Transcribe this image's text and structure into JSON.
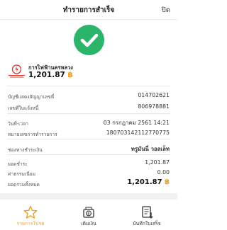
{
  "header": {
    "title": "ทำรายการสำเร็จ",
    "close_label": "ปิด"
  },
  "biller": {
    "logo_text": "การไฟฟ้านครหลวง",
    "name": "การไฟฟ้านครหลวง",
    "amount": "1,201.87",
    "currency_symbol": "฿"
  },
  "details": [
    {
      "label": "บัญชีแสดงสัญญาเลขที่",
      "value": "014702621"
    },
    {
      "label": "เลขที่ใบแจ้งหนี้",
      "value": "806978881"
    },
    {
      "label": "วันที่-เวลา",
      "value": "03 กรกฎาคม 2561 14:21"
    },
    {
      "label": "หมายเลขการทำรายการ",
      "value": "180703142112770775"
    },
    {
      "label": "ช่องทางชำระเงิน",
      "value": "ทรูมันนี่ วอลเล็ท"
    },
    {
      "label": "ยอดชำระ",
      "value": "1,201.87"
    },
    {
      "label": "ค่าธรรมเนียม",
      "value": "0.00"
    },
    {
      "label": "ยอดรวมทั้งหมด",
      "value": "1,201.87",
      "currency_symbol": "฿"
    }
  ],
  "tabs": [
    {
      "label": "รายการโปรด",
      "icon": "star-icon",
      "active": true
    },
    {
      "label": "เติมเงิน",
      "icon": "topup-icon",
      "active": false
    },
    {
      "label": "บันทึกใบเสร็จ",
      "icon": "save-receipt-icon",
      "active": false
    }
  ],
  "colors": {
    "accent": "#f0a020",
    "success": "#2ab56a",
    "logo_red": "#d9312b"
  }
}
